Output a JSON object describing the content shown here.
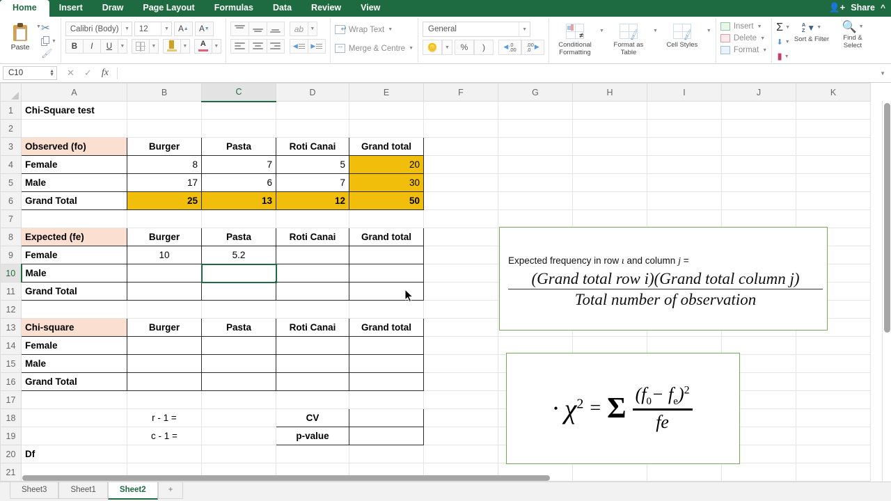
{
  "ribbon": {
    "tabs": [
      {
        "label": "Home",
        "active": true
      },
      {
        "label": "Insert",
        "active": false
      },
      {
        "label": "Draw",
        "active": false
      },
      {
        "label": "Page Layout",
        "active": false
      },
      {
        "label": "Formulas",
        "active": false
      },
      {
        "label": "Data",
        "active": false
      },
      {
        "label": "Review",
        "active": false
      },
      {
        "label": "View",
        "active": false
      }
    ],
    "share_label": "Share",
    "clipboard": {
      "paste_label": "Paste"
    },
    "font": {
      "family_value": "Calibri (Body)",
      "size_value": "12",
      "grow_label": "A",
      "shrink_label": "A",
      "bold_label": "B",
      "italic_label": "I",
      "underline_label": "U"
    },
    "alignment": {
      "wrap_text_label": "Wrap Text",
      "merge_centre_label": "Merge & Centre"
    },
    "number": {
      "format_value": "General",
      "percent_label": "%",
      "comma_label": ")"
    },
    "styles": {
      "conditional_formatting_label": "Conditional Formatting",
      "format_as_table_label": "Format as Table",
      "cell_styles_label": "Cell Styles"
    },
    "cells": {
      "insert_label": "Insert",
      "delete_label": "Delete",
      "format_label": "Format"
    },
    "editing": {
      "autosum_label": "Σ",
      "sort_filter_label": "Sort & Filter",
      "find_select_label": "Find & Select"
    }
  },
  "formula_bar": {
    "name_box_value": "C10",
    "formula_value": "",
    "cancel_label": "✕",
    "enter_label": "✓",
    "fx_label": "fx"
  },
  "grid": {
    "columns": [
      "A",
      "B",
      "C",
      "D",
      "E",
      "F",
      "G",
      "H",
      "I",
      "J",
      "K"
    ],
    "selected_column": "C",
    "selected_row": "10",
    "selected_cell": "C10",
    "rows": [
      {
        "num": "1",
        "cells": [
          {
            "v": "Chi-Square test",
            "cls": "b"
          },
          {
            "v": ""
          },
          {
            "v": ""
          },
          {
            "v": ""
          },
          {
            "v": ""
          },
          {
            "v": ""
          },
          {
            "v": ""
          },
          {
            "v": ""
          },
          {
            "v": ""
          },
          {
            "v": ""
          },
          {
            "v": ""
          }
        ]
      },
      {
        "num": "2",
        "cells": [
          {
            "v": ""
          },
          {
            "v": ""
          },
          {
            "v": ""
          },
          {
            "v": ""
          },
          {
            "v": ""
          },
          {
            "v": ""
          },
          {
            "v": ""
          },
          {
            "v": ""
          },
          {
            "v": ""
          },
          {
            "v": ""
          },
          {
            "v": ""
          }
        ]
      },
      {
        "num": "3",
        "cells": [
          {
            "v": "Observed (fo)",
            "cls": "b box hdrfill"
          },
          {
            "v": "Burger",
            "cls": "b c box"
          },
          {
            "v": "Pasta",
            "cls": "b c box"
          },
          {
            "v": "Roti Canai",
            "cls": "b c box"
          },
          {
            "v": "Grand total",
            "cls": "b c box"
          },
          {
            "v": ""
          },
          {
            "v": ""
          },
          {
            "v": ""
          },
          {
            "v": ""
          },
          {
            "v": ""
          },
          {
            "v": ""
          }
        ]
      },
      {
        "num": "4",
        "cells": [
          {
            "v": "Female",
            "cls": "b box"
          },
          {
            "v": "8",
            "cls": "r box"
          },
          {
            "v": "7",
            "cls": "r box"
          },
          {
            "v": "5",
            "cls": "r box"
          },
          {
            "v": "20",
            "cls": "r box gold"
          },
          {
            "v": ""
          },
          {
            "v": ""
          },
          {
            "v": ""
          },
          {
            "v": ""
          },
          {
            "v": ""
          },
          {
            "v": ""
          }
        ]
      },
      {
        "num": "5",
        "cells": [
          {
            "v": "Male",
            "cls": "b box"
          },
          {
            "v": "17",
            "cls": "r box"
          },
          {
            "v": "6",
            "cls": "r box"
          },
          {
            "v": "7",
            "cls": "r box"
          },
          {
            "v": "30",
            "cls": "r box gold"
          },
          {
            "v": ""
          },
          {
            "v": ""
          },
          {
            "v": ""
          },
          {
            "v": ""
          },
          {
            "v": ""
          },
          {
            "v": ""
          }
        ]
      },
      {
        "num": "6",
        "cells": [
          {
            "v": "Grand Total",
            "cls": "b box"
          },
          {
            "v": "25",
            "cls": "b r box gold"
          },
          {
            "v": "13",
            "cls": "b r box gold"
          },
          {
            "v": "12",
            "cls": "b r box gold"
          },
          {
            "v": "50",
            "cls": "b r box gold"
          },
          {
            "v": ""
          },
          {
            "v": ""
          },
          {
            "v": ""
          },
          {
            "v": ""
          },
          {
            "v": ""
          },
          {
            "v": ""
          }
        ]
      },
      {
        "num": "7",
        "cells": [
          {
            "v": ""
          },
          {
            "v": ""
          },
          {
            "v": ""
          },
          {
            "v": ""
          },
          {
            "v": ""
          },
          {
            "v": ""
          },
          {
            "v": ""
          },
          {
            "v": ""
          },
          {
            "v": ""
          },
          {
            "v": ""
          },
          {
            "v": ""
          }
        ]
      },
      {
        "num": "8",
        "cells": [
          {
            "v": "Expected (fe)",
            "cls": "b box hdrfill"
          },
          {
            "v": "Burger",
            "cls": "b c box"
          },
          {
            "v": "Pasta",
            "cls": "b c box"
          },
          {
            "v": "Roti Canai",
            "cls": "b c box"
          },
          {
            "v": "Grand total",
            "cls": "b c box"
          },
          {
            "v": ""
          },
          {
            "v": ""
          },
          {
            "v": ""
          },
          {
            "v": ""
          },
          {
            "v": ""
          },
          {
            "v": ""
          }
        ]
      },
      {
        "num": "9",
        "cells": [
          {
            "v": "Female",
            "cls": "b box"
          },
          {
            "v": "10",
            "cls": "c box"
          },
          {
            "v": "5.2",
            "cls": "c box"
          },
          {
            "v": "",
            "cls": "box"
          },
          {
            "v": "",
            "cls": "box"
          },
          {
            "v": ""
          },
          {
            "v": ""
          },
          {
            "v": ""
          },
          {
            "v": ""
          },
          {
            "v": ""
          },
          {
            "v": ""
          }
        ]
      },
      {
        "num": "10",
        "cells": [
          {
            "v": "Male",
            "cls": "b box"
          },
          {
            "v": "",
            "cls": "box"
          },
          {
            "v": "",
            "cls": "box selected"
          },
          {
            "v": "",
            "cls": "box"
          },
          {
            "v": "",
            "cls": "box"
          },
          {
            "v": ""
          },
          {
            "v": ""
          },
          {
            "v": ""
          },
          {
            "v": ""
          },
          {
            "v": ""
          },
          {
            "v": ""
          }
        ]
      },
      {
        "num": "11",
        "cells": [
          {
            "v": "Grand Total",
            "cls": "b box"
          },
          {
            "v": "",
            "cls": "box"
          },
          {
            "v": "",
            "cls": "box"
          },
          {
            "v": "",
            "cls": "box"
          },
          {
            "v": "",
            "cls": "box"
          },
          {
            "v": ""
          },
          {
            "v": ""
          },
          {
            "v": ""
          },
          {
            "v": ""
          },
          {
            "v": ""
          },
          {
            "v": ""
          }
        ]
      },
      {
        "num": "12",
        "cells": [
          {
            "v": ""
          },
          {
            "v": ""
          },
          {
            "v": ""
          },
          {
            "v": ""
          },
          {
            "v": ""
          },
          {
            "v": ""
          },
          {
            "v": ""
          },
          {
            "v": ""
          },
          {
            "v": ""
          },
          {
            "v": ""
          },
          {
            "v": ""
          }
        ]
      },
      {
        "num": "13",
        "cells": [
          {
            "v": "Chi-square",
            "cls": "b box hdrfill"
          },
          {
            "v": "Burger",
            "cls": "b c box"
          },
          {
            "v": "Pasta",
            "cls": "b c box"
          },
          {
            "v": "Roti Canai",
            "cls": "b c box"
          },
          {
            "v": "Grand total",
            "cls": "b c box"
          },
          {
            "v": ""
          },
          {
            "v": ""
          },
          {
            "v": ""
          },
          {
            "v": ""
          },
          {
            "v": ""
          },
          {
            "v": ""
          }
        ]
      },
      {
        "num": "14",
        "cells": [
          {
            "v": "Female",
            "cls": "b box"
          },
          {
            "v": "",
            "cls": "box"
          },
          {
            "v": "",
            "cls": "box"
          },
          {
            "v": "",
            "cls": "box"
          },
          {
            "v": "",
            "cls": "box"
          },
          {
            "v": ""
          },
          {
            "v": ""
          },
          {
            "v": ""
          },
          {
            "v": ""
          },
          {
            "v": ""
          },
          {
            "v": ""
          }
        ]
      },
      {
        "num": "15",
        "cells": [
          {
            "v": "Male",
            "cls": "b box"
          },
          {
            "v": "",
            "cls": "box"
          },
          {
            "v": "",
            "cls": "box"
          },
          {
            "v": "",
            "cls": "box"
          },
          {
            "v": "",
            "cls": "box"
          },
          {
            "v": ""
          },
          {
            "v": ""
          },
          {
            "v": ""
          },
          {
            "v": ""
          },
          {
            "v": ""
          },
          {
            "v": ""
          }
        ]
      },
      {
        "num": "16",
        "cells": [
          {
            "v": "Grand Total",
            "cls": "b box"
          },
          {
            "v": "",
            "cls": "box"
          },
          {
            "v": "",
            "cls": "box"
          },
          {
            "v": "",
            "cls": "box"
          },
          {
            "v": "",
            "cls": "box"
          },
          {
            "v": ""
          },
          {
            "v": ""
          },
          {
            "v": ""
          },
          {
            "v": ""
          },
          {
            "v": ""
          },
          {
            "v": ""
          }
        ]
      },
      {
        "num": "17",
        "cells": [
          {
            "v": ""
          },
          {
            "v": ""
          },
          {
            "v": ""
          },
          {
            "v": ""
          },
          {
            "v": ""
          },
          {
            "v": ""
          },
          {
            "v": ""
          },
          {
            "v": ""
          },
          {
            "v": ""
          },
          {
            "v": ""
          },
          {
            "v": ""
          }
        ]
      },
      {
        "num": "18",
        "cells": [
          {
            "v": ""
          },
          {
            "v": "r - 1 =",
            "cls": "c"
          },
          {
            "v": ""
          },
          {
            "v": "CV",
            "cls": "b c box"
          },
          {
            "v": "",
            "cls": "box"
          },
          {
            "v": ""
          },
          {
            "v": ""
          },
          {
            "v": ""
          },
          {
            "v": ""
          },
          {
            "v": ""
          },
          {
            "v": ""
          }
        ]
      },
      {
        "num": "19",
        "cells": [
          {
            "v": ""
          },
          {
            "v": "c - 1 =",
            "cls": "c"
          },
          {
            "v": ""
          },
          {
            "v": "p-value",
            "cls": "b c box"
          },
          {
            "v": "",
            "cls": "box"
          },
          {
            "v": ""
          },
          {
            "v": ""
          },
          {
            "v": ""
          },
          {
            "v": ""
          },
          {
            "v": ""
          },
          {
            "v": ""
          }
        ]
      },
      {
        "num": "20",
        "cells": [
          {
            "v": "Df",
            "cls": "b"
          },
          {
            "v": ""
          },
          {
            "v": ""
          },
          {
            "v": ""
          },
          {
            "v": ""
          },
          {
            "v": ""
          },
          {
            "v": ""
          },
          {
            "v": ""
          },
          {
            "v": ""
          },
          {
            "v": ""
          },
          {
            "v": ""
          }
        ]
      },
      {
        "num": "21",
        "cells": [
          {
            "v": ""
          },
          {
            "v": ""
          },
          {
            "v": ""
          },
          {
            "v": ""
          },
          {
            "v": ""
          },
          {
            "v": ""
          },
          {
            "v": ""
          },
          {
            "v": ""
          },
          {
            "v": ""
          },
          {
            "v": ""
          },
          {
            "v": ""
          }
        ]
      }
    ]
  },
  "textboxes": {
    "expected_formula": {
      "heading_prefix": "Expected frequency in row",
      "heading_i": "ι",
      "heading_mid": "and column",
      "heading_j": "j",
      "heading_eq": "=",
      "numerator": "(Grand total row i)(Grand total column j)",
      "denominator": "Total number of observation"
    },
    "chi_square_formula": {
      "bullet": "•",
      "chi": "χ",
      "chi_exp": "2",
      "equals": "=",
      "sigma": "Σ",
      "numerator_open": "(",
      "numerator_f0": "f",
      "numerator_f0_sub": "0",
      "numerator_minus": "−",
      "numerator_fe": "f",
      "numerator_fe_sub": "e",
      "numerator_close": ")",
      "numerator_exp": "2",
      "denominator": "fe"
    }
  },
  "sheet_tabs": [
    {
      "label": "Sheet3",
      "active": false
    },
    {
      "label": "Sheet1",
      "active": false
    },
    {
      "label": "Sheet2",
      "active": true
    },
    {
      "label": "+",
      "active": false
    }
  ],
  "colors": {
    "brand_green": "#1E6B41",
    "gold_fill": "#F0BE0B",
    "header_fill": "#FBDFD1",
    "textbox_border": "#74AB5A"
  }
}
